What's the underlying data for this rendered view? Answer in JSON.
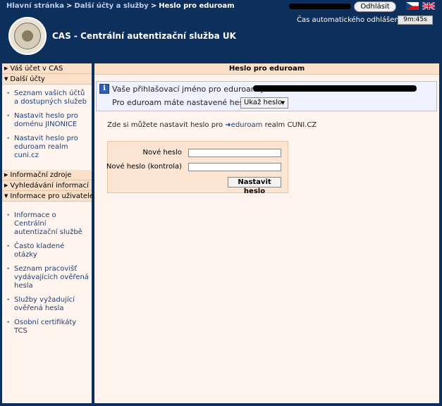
{
  "breadcrumb": {
    "items": [
      "Hlavní stránka",
      "Další účty a služby"
    ],
    "current": "Heslo pro eduroam",
    "separator": ">"
  },
  "header": {
    "logout_label": "Odhlásit",
    "auto_logout_label": "Čas automatického odhlášení:",
    "auto_logout_time": "9m:45s",
    "site_title": "CAS - Centrální autentizační služba UK"
  },
  "sidebar": {
    "sections": [
      {
        "title": "Váš účet v CAS",
        "expanded": false,
        "items": []
      },
      {
        "title": "Další účty",
        "expanded": true,
        "items": [
          {
            "label": "Seznam vašich účtů a dostupných služeb"
          },
          {
            "label": "Nastavit heslo pro doménu JINONICE"
          },
          {
            "label": "Nastavit heslo pro eduroam realm cuni.cz"
          }
        ]
      },
      {
        "title": "Informační zdroje",
        "expanded": false,
        "items": []
      },
      {
        "title": "Vyhledávání informací",
        "expanded": false,
        "items": []
      },
      {
        "title": "Informace pro uživatele",
        "expanded": true,
        "items": [
          {
            "label": "Informace o Centrální autentizační službě"
          },
          {
            "label": "Často kladené otázky"
          },
          {
            "label": "Seznam pracovišť vydávajících ověřená hesla"
          },
          {
            "label": "Služby vyžadující ověřená hesla"
          },
          {
            "label": "Osobní certifikáty TCS"
          }
        ]
      }
    ]
  },
  "main": {
    "title": "Heslo pro eduroam",
    "info": {
      "login_label": "Vaše přihlašovací jméno pro eduroam je:",
      "password_label": "Pro eduroam máte nastavené heslo:",
      "show_password_label": "Ukaž heslo"
    },
    "realm_text_prefix": "Zde si můžete nastavit heslo pro",
    "realm_link": "eduroam",
    "realm_text_suffix": "realm CUNI.CZ",
    "form": {
      "new_password_label": "Nové heslo",
      "confirm_password_label": "Nové heslo (kontrola)",
      "submit_label": "Nastavit heslo"
    }
  },
  "colors": {
    "header_bg": "#0d2f5c",
    "panel_bg": "#fff5ee",
    "section_bg": "#fbe0c9",
    "link": "#1c3e79"
  }
}
